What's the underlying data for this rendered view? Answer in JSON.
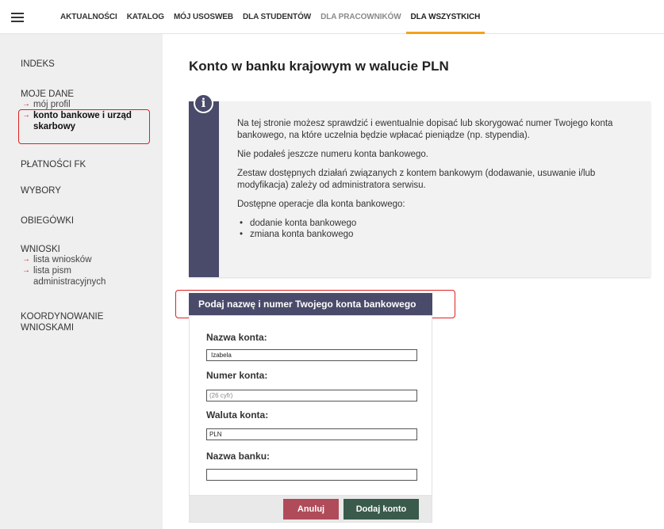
{
  "nav": {
    "items": [
      "AKTUALNOŚCI",
      "KATALOG",
      "MÓJ USOSWEB",
      "DLA STUDENTÓW",
      "DLA PRACOWNIKÓW",
      "DLA WSZYSTKICH"
    ],
    "active": "DLA WSZYSTKICH",
    "muted": "DLA PRACOWNIKÓW",
    "accent_color": "#f3a21c"
  },
  "sidebar": {
    "indeks": "INDEKS",
    "moje_dane": "MOJE DANE",
    "moj_profil": "mój profil",
    "konto_bankowe": "konto bankowe i urząd skarbowy",
    "platnosci": "PŁATNOŚCI FK",
    "wybory": "WYBORY",
    "obiegowki": "OBIEGÓWKI",
    "wnioski": "WNIOSKI",
    "lista_wnioskow": "lista wniosków",
    "lista_pism": "lista pism administracyjnych",
    "koordynowanie": "KOORDYNOWANIE WNIOSKAMI",
    "arrow": "→"
  },
  "main": {
    "title": "Konto w banku krajowym w walucie PLN",
    "info_icon": "i",
    "info_p1": "Na tej stronie możesz sprawdzić i ewentualnie dopisać lub skorygować numer Twojego konta bankowego, na które uczelnia będzie wpłacać pieniądze (np. stypendia).",
    "info_p2": "Nie podałeś jeszcze numeru konta bankowego.",
    "info_p3": "Zestaw dostępnych działań związanych z kontem bankowym (dodawanie, usuwanie i/lub modyfikacja) zależy od administratora serwisu.",
    "info_p4": "Dostępne operacje dla konta bankowego:",
    "info_ops": [
      "dodanie konta bankowego",
      "zmiana konta bankowego"
    ],
    "panel_color": "#4a4a6a"
  },
  "form": {
    "header": "Podaj nazwę i numer Twojego konta bankowego",
    "label_name": "Nazwa konta:",
    "value_name": "Izabela",
    "label_number": "Numer konta:",
    "placeholder_number": "(26 cyfr)",
    "label_currency": "Waluta konta:",
    "value_currency": "PLN",
    "label_bank": "Nazwa banku:",
    "value_bank": "",
    "cancel_label": "Anuluj",
    "add_label": "Dodaj konto",
    "cancel_color": "#b04b5a",
    "add_color": "#3a5a4c"
  }
}
